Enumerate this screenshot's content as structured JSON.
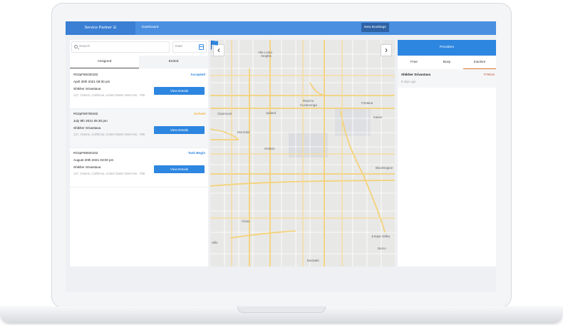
{
  "topbar": {
    "brand": "Service Partner ☰",
    "nav_dashboard": "Dashboard",
    "new_bookings": "New Bookings"
  },
  "left": {
    "search_placeholder": "Search",
    "date_placeholder": "Date",
    "tabs": [
      "Assigned",
      "Ended"
    ],
    "bookings": [
      {
        "id": "#G2pF80430102",
        "status": "Accepted",
        "status_color": "#2d86e0",
        "datetime": "April 30th 2021 08:00 pm",
        "name": "Shikher Srivastava",
        "address": "127, Ontario, California, United States Street No. -788",
        "action": "View Details"
      },
      {
        "id": "#G2pF80709102",
        "status": "Arrived",
        "status_color": "#f2b13a",
        "datetime": "July 9th 2021 05:30 pm",
        "name": "Shikher Srivastava",
        "address": "127, Ontario, California, United States Street No. -788",
        "action": "View Details"
      },
      {
        "id": "#G2pF80820102",
        "status": "Task Begin",
        "status_color": "#2d86e0",
        "datetime": "August 20th 2021 03:00 pm",
        "name": "Shikher Srivastava",
        "address": "127, Ontario, California, United States Street No. -788",
        "action": "View Details"
      }
    ]
  },
  "map": {
    "places": [
      "Alta Loma",
      "Heights",
      "Rancho",
      "Cucamonga",
      "Upland",
      "Claremont",
      "Montclair",
      "Ontario",
      "Fontana",
      "Kaiser",
      "Bloomington",
      "Chino",
      "Jurupa Valley",
      "Eastvale",
      "Norco",
      "Hills"
    ],
    "marker_icon": "flag-icon",
    "prev_icon": "chevron-left-icon",
    "next_icon": "chevron-right-icon"
  },
  "right": {
    "header": "Providers",
    "tabs": [
      "Free",
      "Busy",
      "Inactive"
    ],
    "provider": {
      "name": "Shikher Srivastava",
      "code": "#78919",
      "ago": "5 days ago"
    }
  }
}
